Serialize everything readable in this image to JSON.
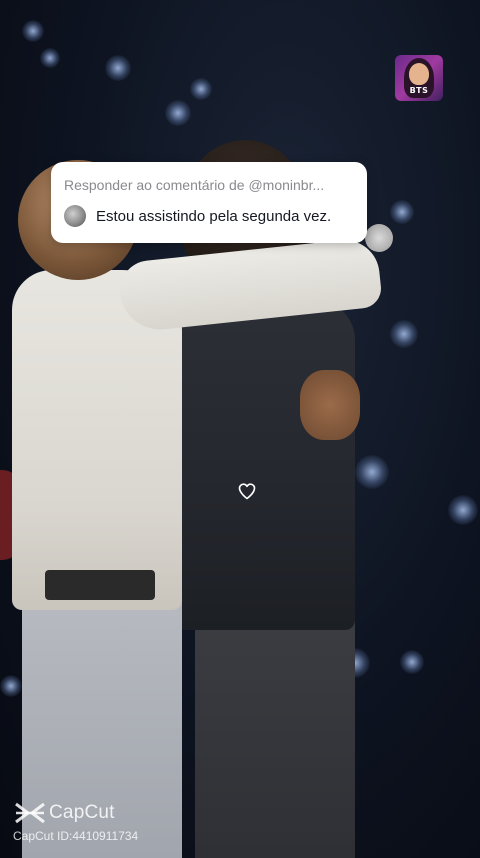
{
  "reply": {
    "title": "Responder ao comentário de @moninbr...",
    "comment": "Estou assistindo pela segunda vez."
  },
  "profile": {
    "badge": "BTS"
  },
  "watermark": {
    "brand": "CapCut",
    "id_text": "CapCut ID:4410911734"
  },
  "icons": {
    "heart": "heart-outline-icon",
    "capcut": "capcut-logo-icon",
    "avatar": "comment-user-avatar"
  },
  "colors": {
    "card_bg": "#ffffff",
    "title_gray": "#8a8a8f",
    "comment_text": "#161823"
  }
}
